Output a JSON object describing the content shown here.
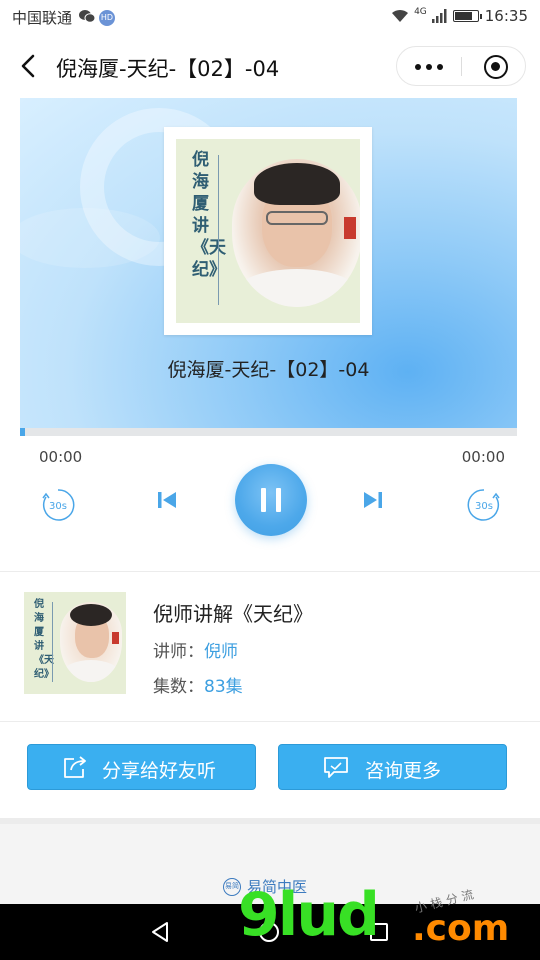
{
  "status_bar": {
    "carrier": "中国联通",
    "hd_badge": "HD",
    "network": "4G",
    "time": "16:35"
  },
  "nav": {
    "title": "倪海厦-天纪-【02】-04"
  },
  "player": {
    "cover_text": "倪海厦讲《天纪》",
    "cover_seal": "倪海厦",
    "track_title": "倪海厦-天纪-【02】-04",
    "current_time": "00:00",
    "total_time": "00:00",
    "progress": 0.01,
    "state": "playing",
    "skip_back_label": "30s",
    "skip_forward_label": "30s"
  },
  "course": {
    "title": "倪师讲解《天纪》",
    "lecturer_label": "讲师：",
    "lecturer": "倪师",
    "episodes_label": "集数：",
    "episodes": "83集"
  },
  "actions": {
    "share_label": "分享给好友听",
    "consult_label": "咨询更多"
  },
  "footer": {
    "brand": "易简中医",
    "brand_logo_text": "易简"
  },
  "watermark": {
    "main": "9lud",
    "suffix": ".com",
    "small": "小栈分流"
  },
  "colors": {
    "accent": "#3aaff0",
    "link": "#3d9fe0",
    "seal_red": "#c83a2e"
  }
}
